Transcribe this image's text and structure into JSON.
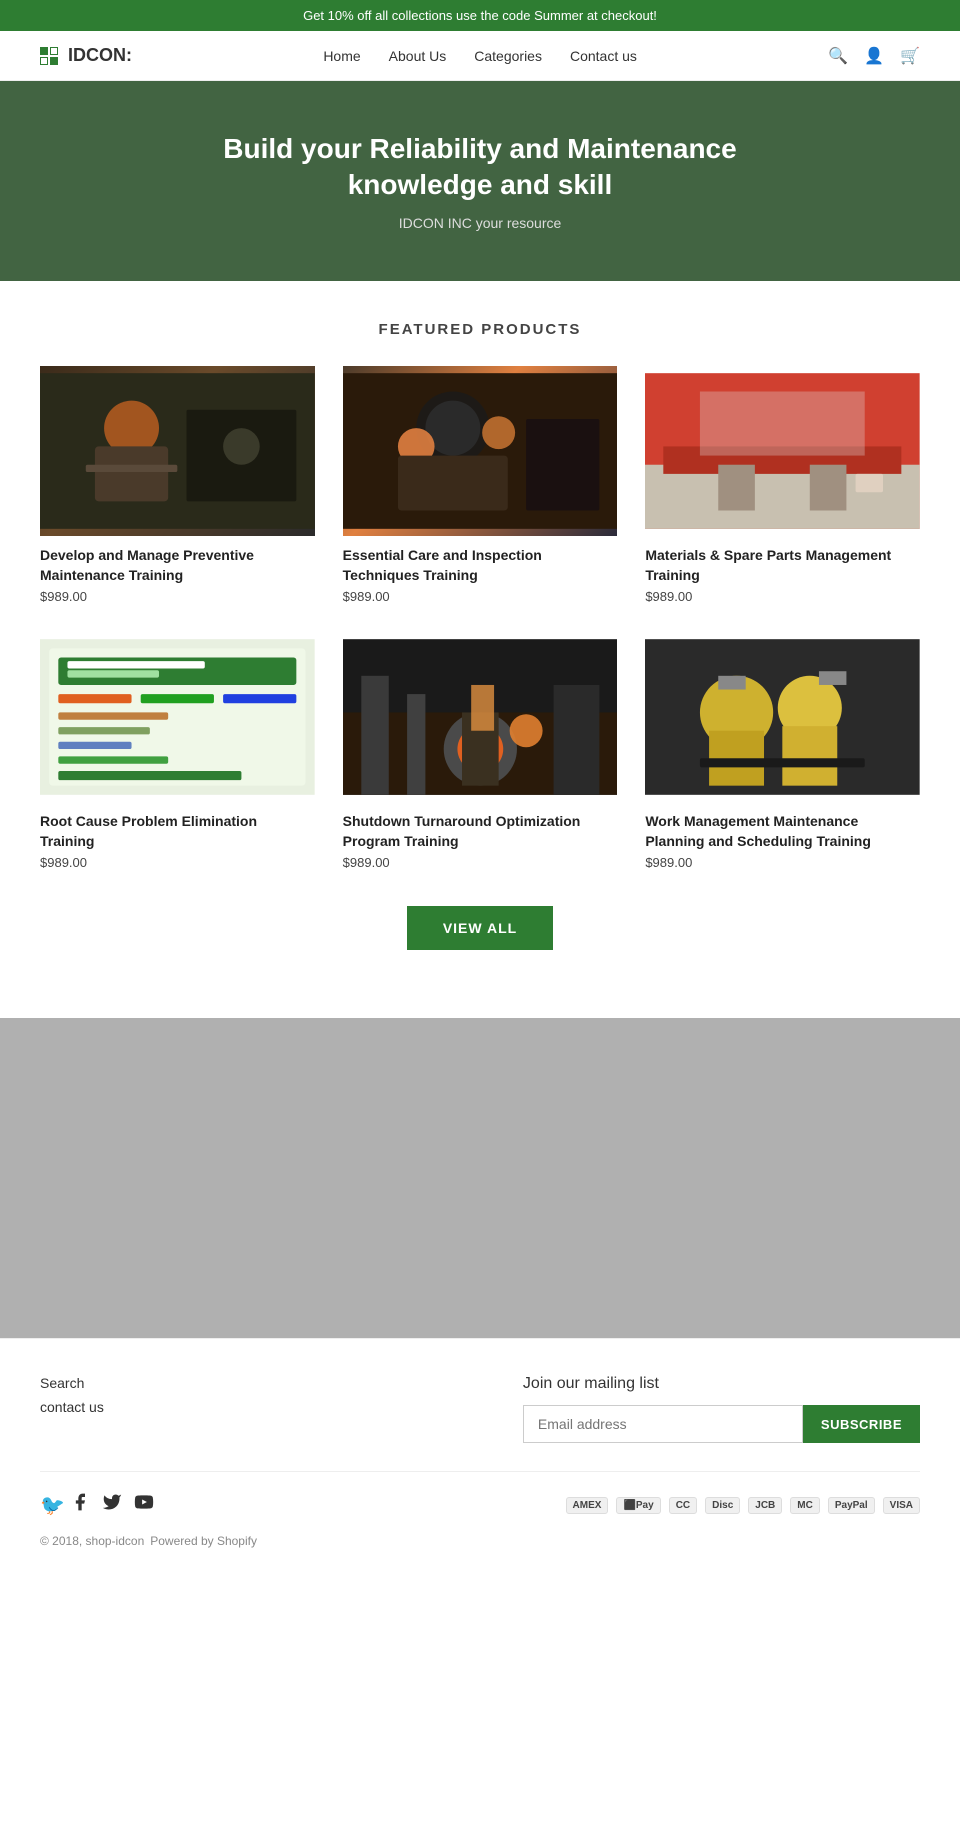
{
  "announcement": {
    "text": "Get 10% off all collections use the code Summer at checkout!"
  },
  "header": {
    "logo_text": "IDCON:",
    "nav": [
      {
        "label": "Home",
        "href": "#"
      },
      {
        "label": "About Us",
        "href": "#"
      },
      {
        "label": "Categories",
        "href": "#"
      },
      {
        "label": "Contact us",
        "href": "#"
      }
    ]
  },
  "hero": {
    "title": "Build your Reliability and Maintenance knowledge and skill",
    "subtitle": "IDCON INC your resource"
  },
  "featured": {
    "section_title": "FEATURED PRODUCTS",
    "products": [
      {
        "title": "Develop and Manage Preventive Maintenance Training",
        "price": "$989.00",
        "img_class": "img-workers-dark"
      },
      {
        "title": "Essential Care and Inspection Techniques Training",
        "price": "$989.00",
        "img_class": "img-workers-orange"
      },
      {
        "title": "Materials & Spare Parts Management Training",
        "price": "$989.00",
        "img_class": "img-warehouse"
      },
      {
        "title": "Root Cause Problem Elimination Training",
        "price": "$989.00",
        "img_class": "img-diagram"
      },
      {
        "title": "Shutdown Turnaround Optimization Program Training",
        "price": "$989.00",
        "img_class": "img-pipes-orange"
      },
      {
        "title": "Work Management Maintenance Planning and Scheduling Training",
        "price": "$989.00",
        "img_class": "img-workers-yellow"
      }
    ],
    "view_all_label": "VIEW ALL"
  },
  "footer": {
    "links": [
      {
        "label": "Search"
      },
      {
        "label": "contact us"
      }
    ],
    "mailing": {
      "heading": "Join our mailing list",
      "placeholder": "Email address",
      "subscribe_label": "SUBSCRIBE"
    },
    "payments": [
      "AMEX",
      "Apple",
      "CC",
      "Disc",
      "JCB",
      "MC",
      "PayPal",
      "VISA"
    ],
    "copyright": "© 2018, shop-idcon",
    "powered_by": "Powered by Shopify"
  }
}
